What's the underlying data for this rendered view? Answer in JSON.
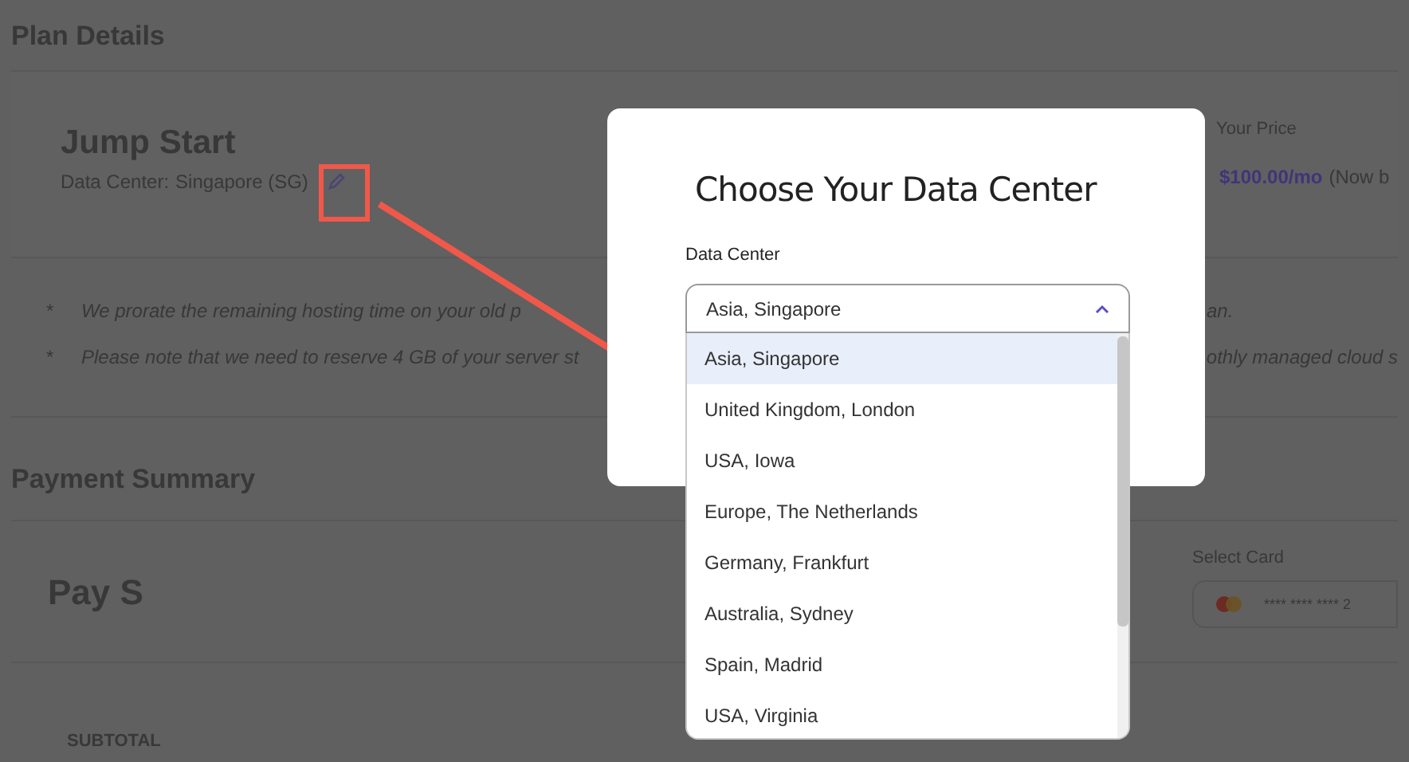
{
  "page": {
    "plan_details": {
      "heading": "Plan Details",
      "plan_name": "Jump Start",
      "data_center_label": "Data Center:",
      "data_center_value": "Singapore (SG)",
      "price_label": "Your Price",
      "price": "$100.00/mo",
      "price_note": "(Now b"
    },
    "notes": [
      {
        "bullet": "*",
        "left": "We prorate the remaining hosting time on your old p",
        "right": "an."
      },
      {
        "bullet": "*",
        "left": "Please note that we need to reserve 4 GB of your server st",
        "right": "othly managed cloud s"
      }
    ],
    "payment_summary": {
      "heading": "Payment Summary",
      "title": "Pay S",
      "select_card_label": "Select Card",
      "card_number": "**** **** **** 2",
      "subtotal_label": "SUBTOTAL"
    }
  },
  "modal": {
    "title": "Choose Your Data Center",
    "field_label": "Data Center",
    "value": "Asia, Singapore",
    "options": [
      {
        "label": "Asia, Singapore",
        "selected": true
      },
      {
        "label": "United Kingdom, London",
        "selected": false
      },
      {
        "label": "USA, Iowa",
        "selected": false
      },
      {
        "label": "Europe, The Netherlands",
        "selected": false
      },
      {
        "label": "Germany, Frankfurt",
        "selected": false
      },
      {
        "label": "Australia, Sydney",
        "selected": false
      },
      {
        "label": "Spain, Madrid",
        "selected": false
      },
      {
        "label": "USA, Virginia",
        "selected": false
      }
    ]
  }
}
